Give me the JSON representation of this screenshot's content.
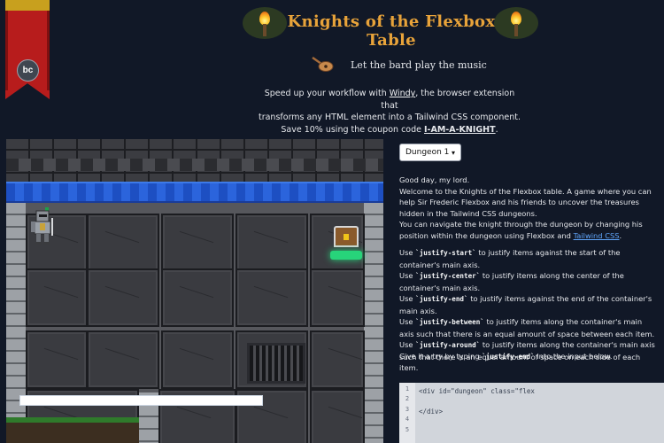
{
  "header": {
    "title": "Knights of the Flexbox Table",
    "bard_text": "Let the bard play the music",
    "logo_text": "bc"
  },
  "promo": {
    "line1_prefix": "Speed up your workflow with ",
    "windy": "Windy",
    "line1_suffix": ", the browser extension that",
    "line2": "transforms any HTML element into a Tailwind CSS component.",
    "line3_prefix": "Save 10% using the coupon code ",
    "coupon": "I-AM-A-KNIGHT",
    "line3_suffix": "."
  },
  "level_select": {
    "value": "Dungeon 1"
  },
  "intro": {
    "greeting": "Good day, my lord.",
    "p1": "Welcome to the Knights of the Flexbox table. A game where you can help Sir Frederic Flexbox and his friends to uncover the treasures hidden in the Tailwind CSS dungeons.",
    "p2_prefix": "You can navigate the knight through the dungeon by changing his position within the dungeon using Flexbox and ",
    "p2_link": "Tailwind CSS",
    "p2_suffix": "."
  },
  "rules": [
    {
      "pre": "Use ",
      "code": "`justify-start`",
      "post": " to justify items against the start of the container's main axis."
    },
    {
      "pre": "Use ",
      "code": "`justify-center`",
      "post": " to justify items along the center of the container's main axis."
    },
    {
      "pre": "Use ",
      "code": "`justify-end`",
      "post": " to justify items against the end of the container's main axis."
    },
    {
      "pre": "Use ",
      "code": "`justify-between`",
      "post": " to justify items along the container's main axis such that there is an equal amount of space between each item."
    },
    {
      "pre": "Use ",
      "code": "`justify-around`",
      "post": " to justify items along the container's main axis such that there is an equal amount of space on each side of each item."
    }
  ],
  "tryit": {
    "pre": "Give it a try by typing ",
    "code": "`justify-end`",
    "post": " into the input below."
  },
  "editor": {
    "line_numbers": [
      "1",
      "2",
      "3",
      "4",
      "5"
    ],
    "code_line1": "<div id=\"dungeon\" class=\"flex",
    "code_line3": "</div>",
    "answer_value": ""
  },
  "colors": {
    "title_orange": "#e8a33a",
    "ribbon_red": "#b71c1c",
    "water_blue": "#2b64dc",
    "chest_glow": "#27d47a",
    "link_blue": "#60a5fa"
  },
  "icons": [
    "torch-icon",
    "lute-icon",
    "knight-sprite",
    "treasure-chest-sprite",
    "chevron-down-icon"
  ]
}
